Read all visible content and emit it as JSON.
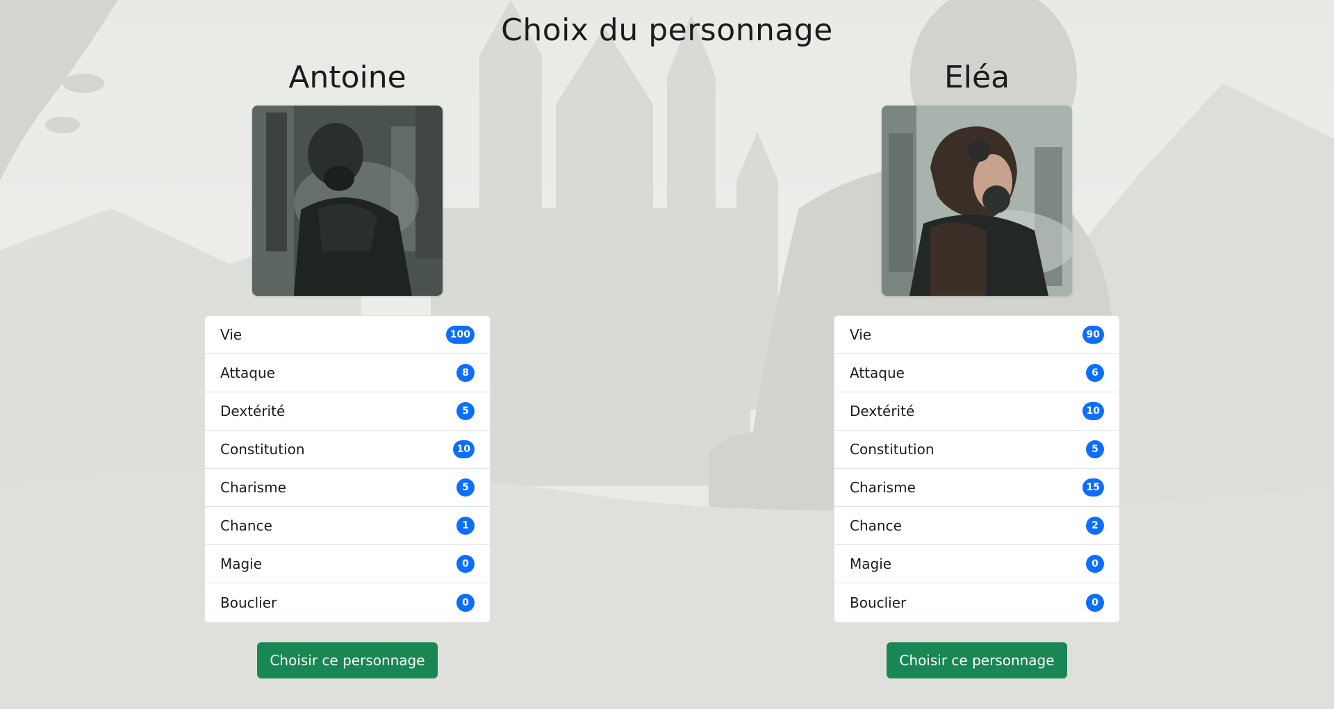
{
  "page": {
    "title": "Choix du personnage"
  },
  "characters": [
    {
      "name": "Antoine",
      "portrait_icon": "gas-mask-man-portrait",
      "stats": [
        {
          "label": "Vie",
          "value": "100"
        },
        {
          "label": "Attaque",
          "value": "8"
        },
        {
          "label": "Dextérité",
          "value": "5"
        },
        {
          "label": "Constitution",
          "value": "10"
        },
        {
          "label": "Charisme",
          "value": "5"
        },
        {
          "label": "Chance",
          "value": "1"
        },
        {
          "label": "Magie",
          "value": "0"
        },
        {
          "label": "Bouclier",
          "value": "0"
        }
      ],
      "button_label": "Choisir ce personnage"
    },
    {
      "name": "Eléa",
      "portrait_icon": "gas-mask-woman-portrait",
      "stats": [
        {
          "label": "Vie",
          "value": "90"
        },
        {
          "label": "Attaque",
          "value": "6"
        },
        {
          "label": "Dextérité",
          "value": "10"
        },
        {
          "label": "Constitution",
          "value": "5"
        },
        {
          "label": "Charisme",
          "value": "15"
        },
        {
          "label": "Chance",
          "value": "2"
        },
        {
          "label": "Magie",
          "value": "0"
        },
        {
          "label": "Bouclier",
          "value": "0"
        }
      ],
      "button_label": "Choisir ce personnage"
    }
  ],
  "colors": {
    "badge": "#0d6efd",
    "button": "#198754",
    "background": "#e7e8e4"
  }
}
